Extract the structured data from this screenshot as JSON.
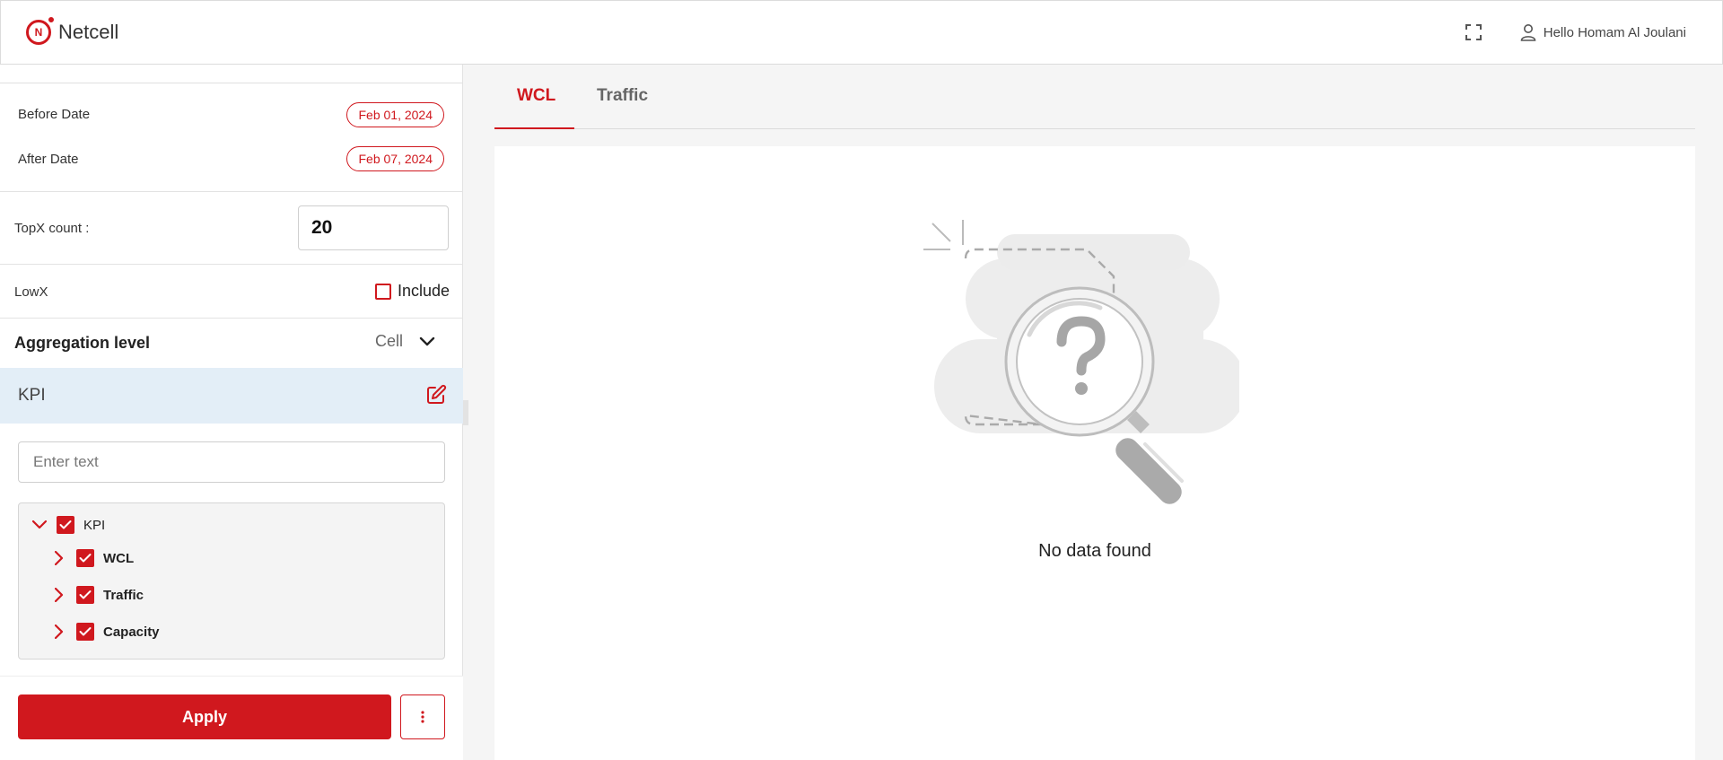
{
  "app": {
    "brand": "Netcell",
    "brand_mark": "N",
    "user_greeting": "Hello Homam Al Joulani",
    "accent": "#d0181e"
  },
  "icons": {
    "fullscreen": "fullscreen-icon",
    "user": "user-icon",
    "edit": "edit-icon",
    "more": "more-vertical-icon",
    "chevron_down": "chevron-down-icon",
    "chevron_right": "chevron-right-icon",
    "check": "check-icon",
    "no_data": "magnifier-question-illustration"
  },
  "filters": {
    "before_date_label": "Before Date",
    "before_date_value": "Feb 01, 2024",
    "after_date_label": "After Date",
    "after_date_value": "Feb 07, 2024",
    "topx_label": "TopX count :",
    "topx_value": "20",
    "lowx_label": "LowX",
    "lowx_include_label": "Include",
    "lowx_include_checked": false,
    "aggregation_label": "Aggregation level",
    "aggregation_value": "Cell"
  },
  "kpi": {
    "section_title": "KPI",
    "search_placeholder": "Enter text",
    "tree": {
      "root": {
        "label": "KPI",
        "checked": true,
        "expanded": true
      },
      "children": [
        {
          "label": "WCL",
          "checked": true,
          "expanded": false
        },
        {
          "label": "Traffic",
          "checked": true,
          "expanded": false
        },
        {
          "label": "Capacity",
          "checked": true,
          "expanded": false
        }
      ]
    }
  },
  "actions": {
    "apply_label": "Apply"
  },
  "main": {
    "tabs": [
      {
        "label": "WCL",
        "active": true
      },
      {
        "label": "Traffic",
        "active": false
      }
    ],
    "empty_message": "No data found"
  }
}
